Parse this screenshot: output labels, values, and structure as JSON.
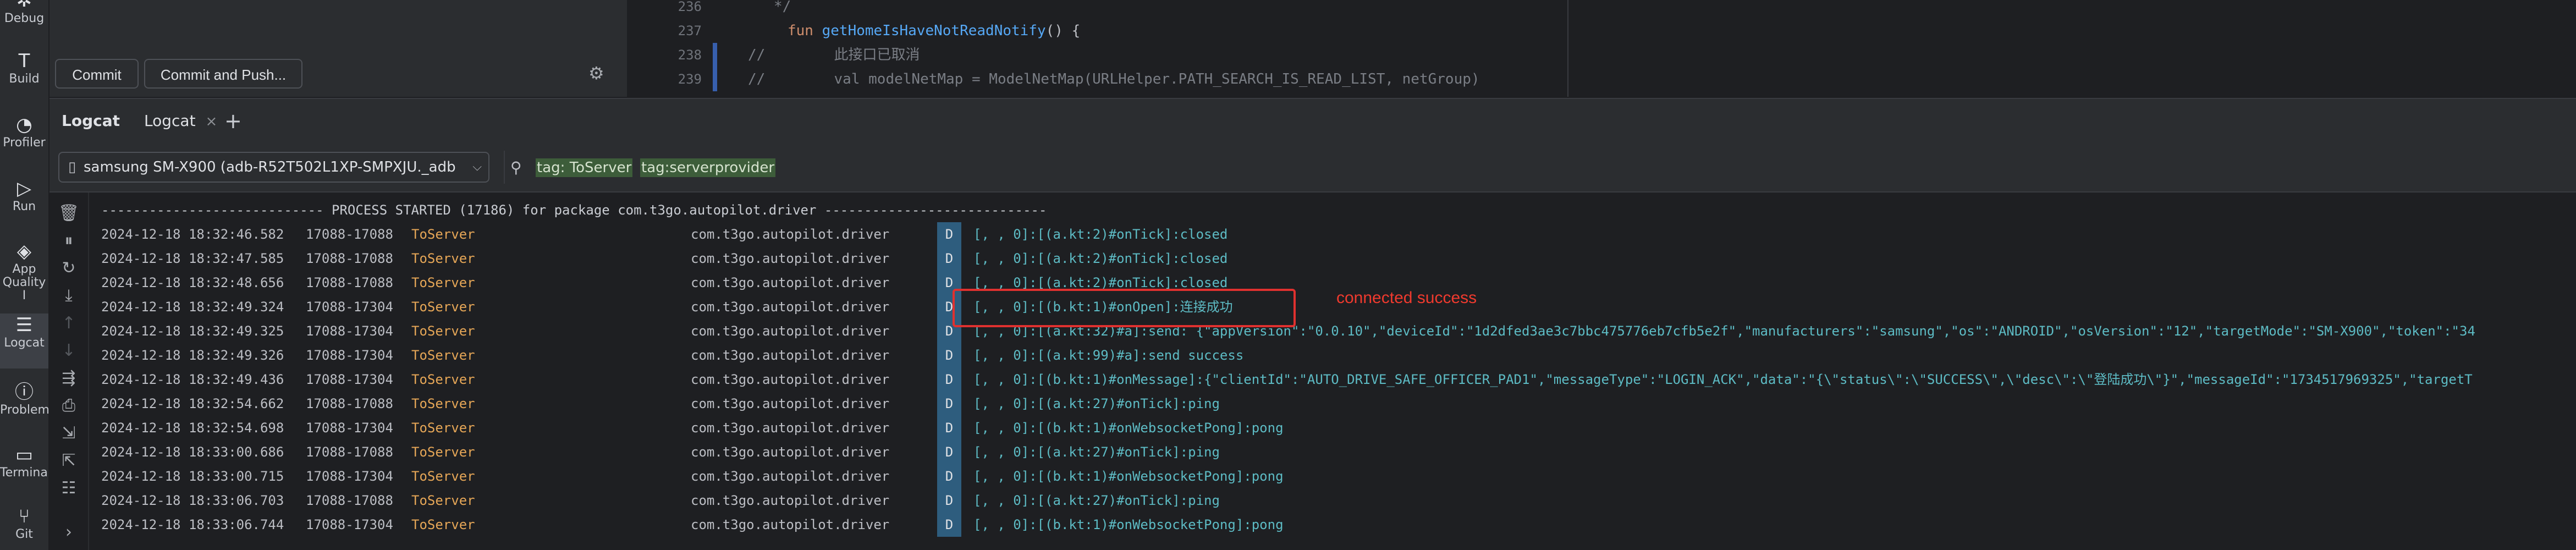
{
  "toolstrip": {
    "items": [
      {
        "label": "Debug"
      },
      {
        "label": "Build"
      },
      {
        "label": "Profiler"
      },
      {
        "label": "Run"
      },
      {
        "label": "App Quality I"
      },
      {
        "label": "Logcat"
      },
      {
        "label": "Problem"
      },
      {
        "label": "Terminal"
      },
      {
        "label": "Git"
      }
    ]
  },
  "commit": {
    "commit_label": "Commit",
    "commit_push_label": "Commit and Push..."
  },
  "editor": {
    "lines": [
      {
        "num": "236",
        "text": "   */"
      },
      {
        "num": "237",
        "kw": "fun ",
        "fn": "getHomeIsHaveNotReadNotify",
        "rest": "() {"
      },
      {
        "num": "238",
        "comment": "//        此接口已取消"
      },
      {
        "num": "239",
        "comment": "//        val modelNetMap = ModelNetMap(URLHelper.PATH_SEARCH_IS_READ_LIST, netGroup)"
      }
    ]
  },
  "logcat": {
    "panel_title": "Logcat",
    "tab_label": "Logcat",
    "tab_close": "×",
    "tab_add": "+",
    "device": "samsung SM-X900 (adb-R52T502L1XP-SMPXJU._adb",
    "filter_tokens": [
      "tag: ToServer",
      "tag:serverprovider"
    ],
    "process_started": "---------------------------- PROCESS STARTED (17186) for package com.t3go.autopilot.driver ----------------------------",
    "rows": [
      {
        "ts": "2024-12-18 18:32:46.582",
        "pid": "17088-17088",
        "tag": "ToServer",
        "pkg": "com.t3go.autopilot.driver",
        "level": "D",
        "msg": "[, , 0]:[(a.kt:2)#onTick]:closed"
      },
      {
        "ts": "2024-12-18 18:32:47.585",
        "pid": "17088-17088",
        "tag": "ToServer",
        "pkg": "com.t3go.autopilot.driver",
        "level": "D",
        "msg": "[, , 0]:[(a.kt:2)#onTick]:closed"
      },
      {
        "ts": "2024-12-18 18:32:48.656",
        "pid": "17088-17088",
        "tag": "ToServer",
        "pkg": "com.t3go.autopilot.driver",
        "level": "D",
        "msg": "[, , 0]:[(a.kt:2)#onTick]:closed"
      },
      {
        "ts": "2024-12-18 18:32:49.324",
        "pid": "17088-17304",
        "tag": "ToServer",
        "pkg": "com.t3go.autopilot.driver",
        "level": "D",
        "msg": "[, , 0]:[(b.kt:1)#onOpen]:连接成功"
      },
      {
        "ts": "2024-12-18 18:32:49.325",
        "pid": "17088-17304",
        "tag": "ToServer",
        "pkg": "com.t3go.autopilot.driver",
        "level": "D",
        "msg": "[, , 0]:[(a.kt:32)#a]:send: {\"appVersion\":\"0.0.10\",\"deviceId\":\"1d2dfed3ae3c7bbc475776eb7cfb5e2f\",\"manufacturers\":\"samsung\",\"os\":\"ANDROID\",\"osVersion\":\"12\",\"targetMode\":\"SM-X900\",\"token\":\"34"
      },
      {
        "ts": "2024-12-18 18:32:49.326",
        "pid": "17088-17304",
        "tag": "ToServer",
        "pkg": "com.t3go.autopilot.driver",
        "level": "D",
        "msg": "[, , 0]:[(a.kt:99)#a]:send success"
      },
      {
        "ts": "2024-12-18 18:32:49.436",
        "pid": "17088-17304",
        "tag": "ToServer",
        "pkg": "com.t3go.autopilot.driver",
        "level": "D",
        "msg": "[, , 0]:[(b.kt:1)#onMessage]:{\"clientId\":\"AUTO_DRIVE_SAFE_OFFICER_PAD1\",\"messageType\":\"LOGIN_ACK\",\"data\":\"{\\\"status\\\":\\\"SUCCESS\\\",\\\"desc\\\":\\\"登陆成功\\\"}\",\"messageId\":\"1734517969325\",\"targetT"
      },
      {
        "ts": "2024-12-18 18:32:54.662",
        "pid": "17088-17088",
        "tag": "ToServer",
        "pkg": "com.t3go.autopilot.driver",
        "level": "D",
        "msg": "[, , 0]:[(a.kt:27)#onTick]:ping"
      },
      {
        "ts": "2024-12-18 18:32:54.698",
        "pid": "17088-17304",
        "tag": "ToServer",
        "pkg": "com.t3go.autopilot.driver",
        "level": "D",
        "msg": "[, , 0]:[(b.kt:1)#onWebsocketPong]:pong"
      },
      {
        "ts": "2024-12-18 18:33:00.686",
        "pid": "17088-17088",
        "tag": "ToServer",
        "pkg": "com.t3go.autopilot.driver",
        "level": "D",
        "msg": "[, , 0]:[(a.kt:27)#onTick]:ping"
      },
      {
        "ts": "2024-12-18 18:33:00.715",
        "pid": "17088-17304",
        "tag": "ToServer",
        "pkg": "com.t3go.autopilot.driver",
        "level": "D",
        "msg": "[, , 0]:[(b.kt:1)#onWebsocketPong]:pong"
      },
      {
        "ts": "2024-12-18 18:33:06.703",
        "pid": "17088-17088",
        "tag": "ToServer",
        "pkg": "com.t3go.autopilot.driver",
        "level": "D",
        "msg": "[, , 0]:[(a.kt:27)#onTick]:ping"
      },
      {
        "ts": "2024-12-18 18:33:06.744",
        "pid": "17088-17304",
        "tag": "ToServer",
        "pkg": "com.t3go.autopilot.driver",
        "level": "D",
        "msg": "[, , 0]:[(b.kt:1)#onWebsocketPong]:pong"
      }
    ]
  },
  "annotation": {
    "text": "connected success",
    "color": "#f03a2e"
  },
  "icons": {
    "debug": "bug-icon",
    "build": "hammer-icon",
    "profiler": "gauge-icon",
    "run": "play-icon",
    "app_quality": "diamond-icon",
    "logcat": "logcat-icon",
    "problems": "alert-icon",
    "terminal": "terminal-icon",
    "git": "branch-icon"
  }
}
